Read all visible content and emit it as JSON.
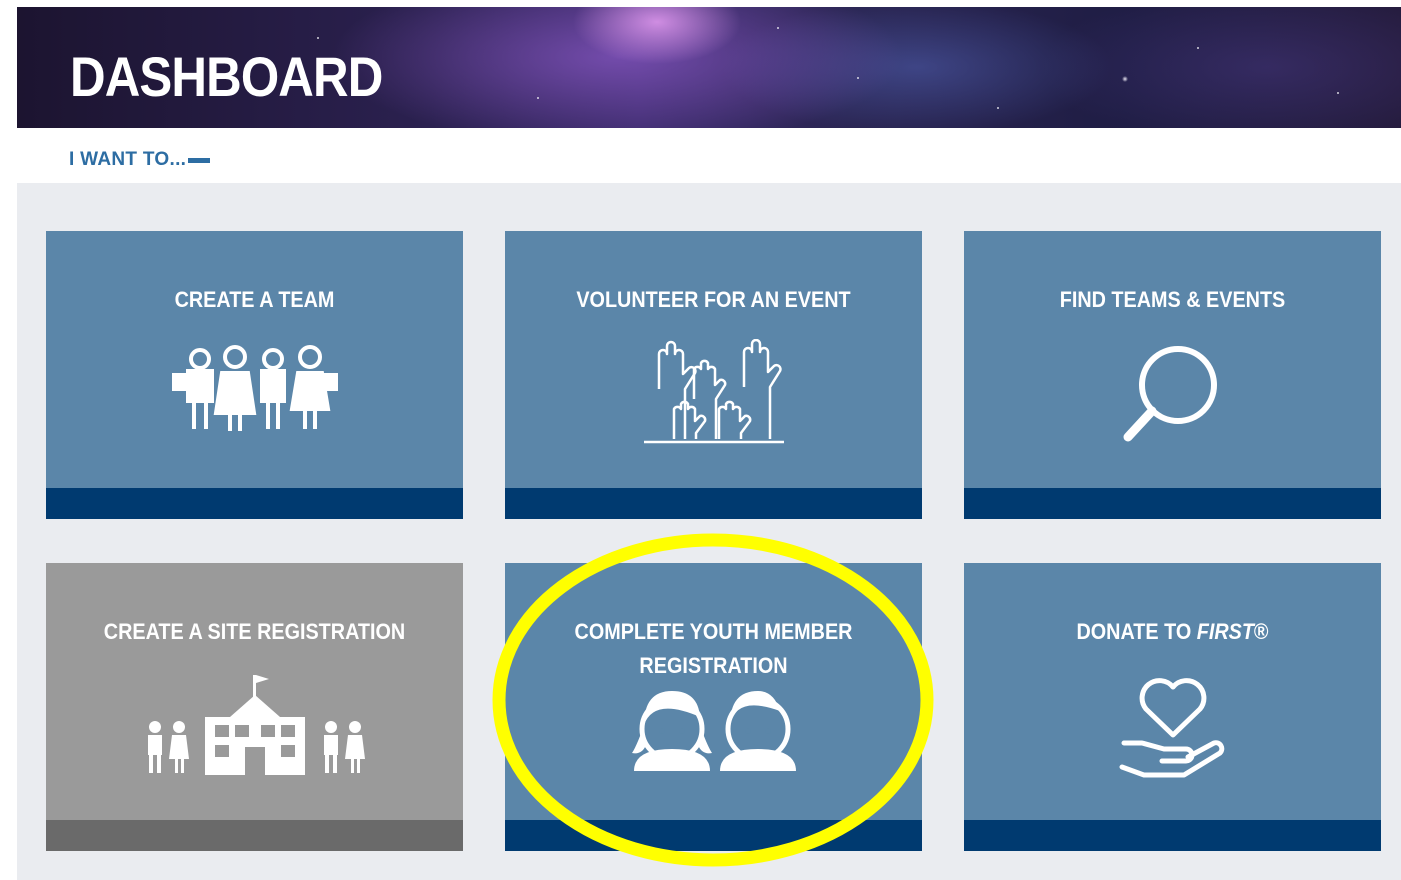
{
  "header": {
    "title": "DASHBOARD"
  },
  "section": {
    "label": "I WANT TO..."
  },
  "tiles": [
    {
      "label": "CREATE A TEAM",
      "icon": "team-group-icon",
      "color": "#5b86a9"
    },
    {
      "label": "VOLUNTEER FOR AN EVENT",
      "icon": "raised-hands-icon",
      "color": "#5b86a9"
    },
    {
      "label": "FIND TEAMS & EVENTS",
      "icon": "magnifier-icon",
      "color": "#5b86a9"
    },
    {
      "label": "CREATE A SITE REGISTRATION",
      "icon": "school-building-icon",
      "color": "#9a9a9a"
    },
    {
      "label_line1": "COMPLETE YOUTH MEMBER",
      "label_line2": "REGISTRATION",
      "icon": "youth-faces-icon",
      "color": "#5b86a9"
    },
    {
      "label_prefix": "DONATE TO ",
      "label_emph": "FIRST",
      "label_suffix": "®",
      "icon": "heart-in-hand-icon",
      "color": "#5b86a9"
    }
  ],
  "colors": {
    "accent": "#2d6da3",
    "tile_bar": "#003a70",
    "highlight": "#ffff00"
  }
}
